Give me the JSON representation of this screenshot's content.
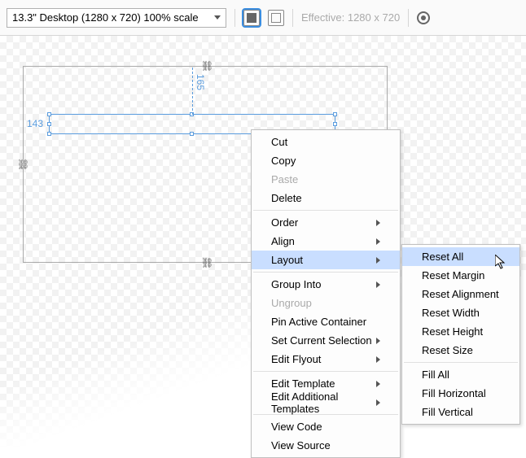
{
  "toolbar": {
    "resolution": "13.3\" Desktop (1280 x 720) 100% scale",
    "effective": "Effective: 1280 x 720"
  },
  "guides": {
    "vertical": "165",
    "horizontal": "143"
  },
  "menu": {
    "cut": "Cut",
    "copy": "Copy",
    "paste": "Paste",
    "delete": "Delete",
    "order": "Order",
    "align": "Align",
    "layout": "Layout",
    "group": "Group Into",
    "ungroup": "Ungroup",
    "pin": "Pin Active Container",
    "setsel": "Set Current Selection",
    "flyout": "Edit Flyout",
    "template": "Edit Template",
    "addtmpl": "Edit Additional Templates",
    "viewcode": "View Code",
    "viewsrc": "View Source"
  },
  "submenu": {
    "resetall": "Reset All",
    "resetmargin": "Reset Margin",
    "resetalign": "Reset Alignment",
    "resetwidth": "Reset Width",
    "resetheight": "Reset Height",
    "resetsize": "Reset Size",
    "fillall": "Fill All",
    "fillh": "Fill Horizontal",
    "fillv": "Fill Vertical"
  }
}
